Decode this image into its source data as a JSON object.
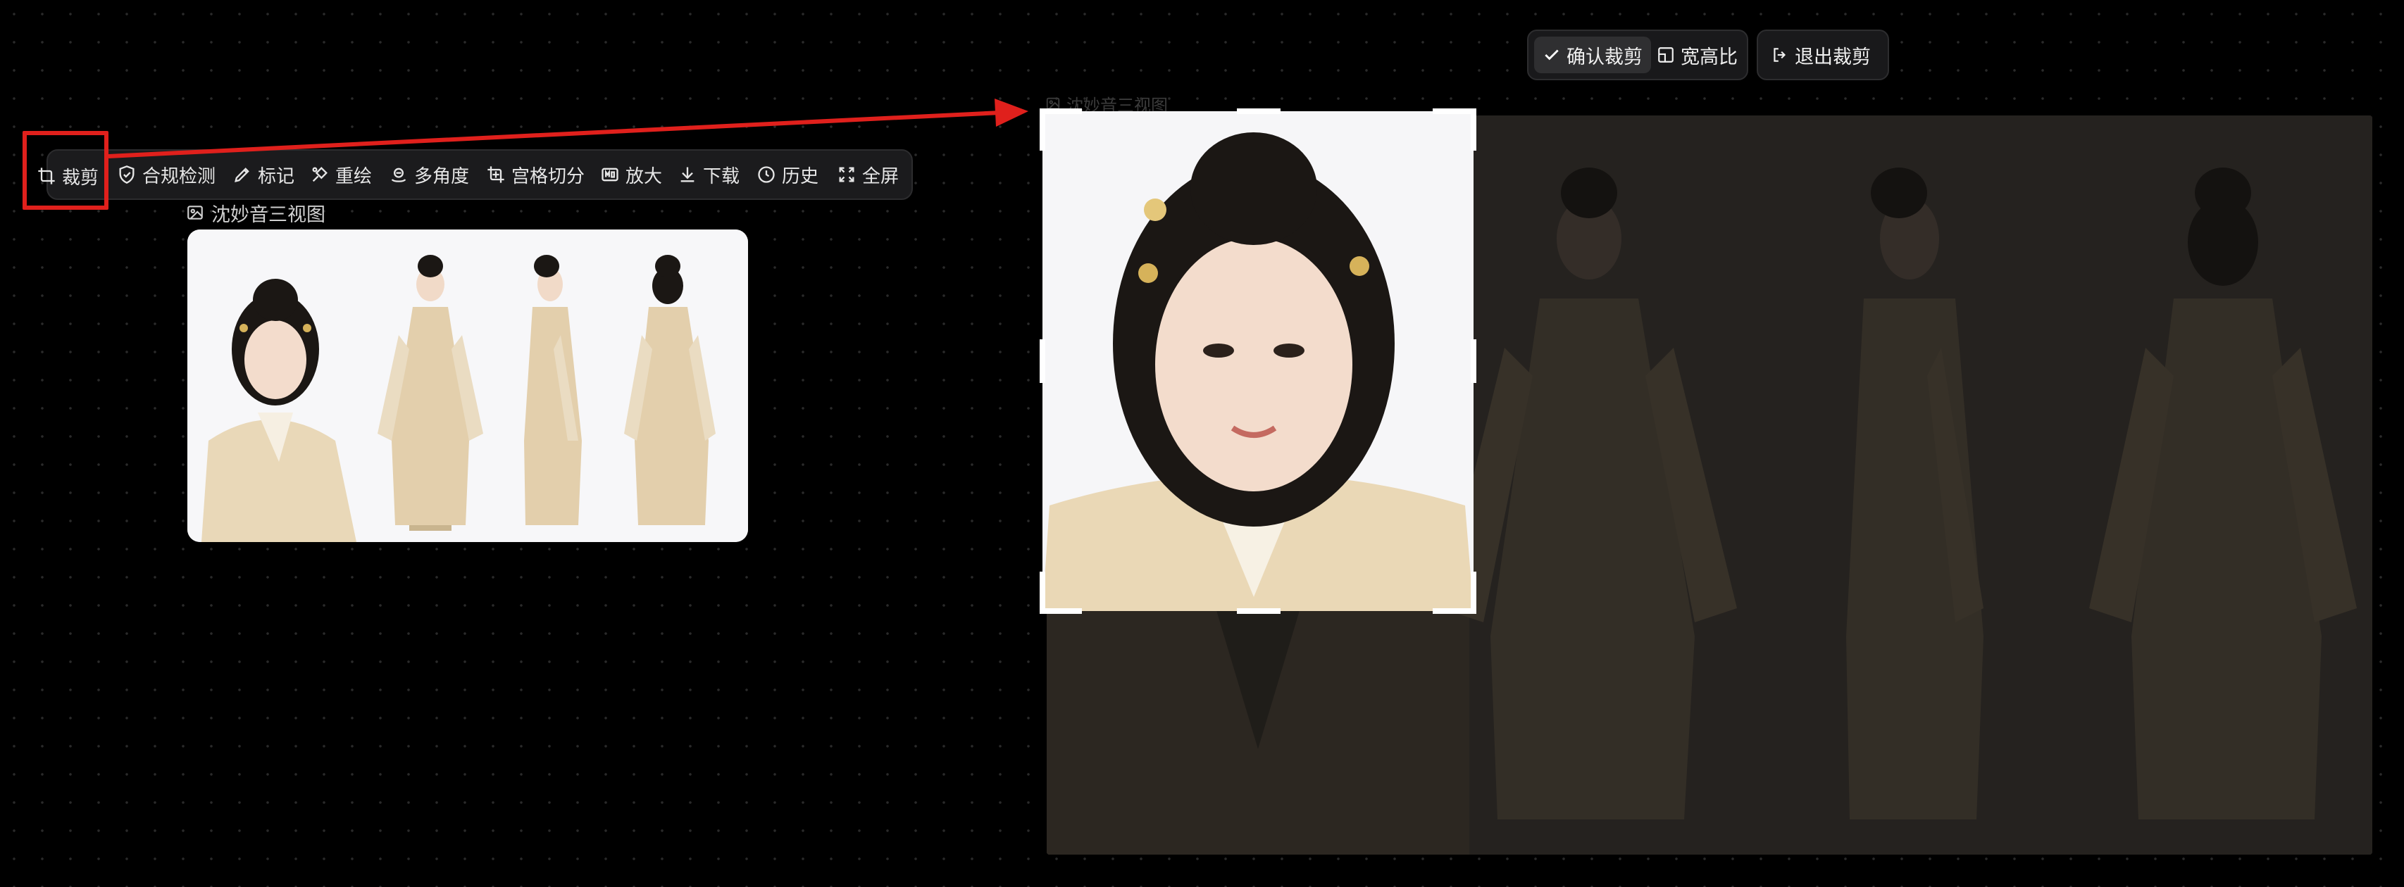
{
  "toolbar": {
    "items": [
      {
        "label": "裁剪",
        "icon": "crop-icon"
      },
      {
        "label": "合规检测",
        "icon": "shield-check-icon"
      },
      {
        "label": "标记",
        "icon": "pen-icon"
      },
      {
        "label": "重绘",
        "icon": "redraw-icon"
      },
      {
        "label": "多角度",
        "icon": "multi-angle-icon"
      },
      {
        "label": "宫格切分",
        "icon": "grid-split-icon"
      },
      {
        "label": "放大",
        "icon": "upscale-icon"
      },
      {
        "label": "下载",
        "icon": "download-icon"
      },
      {
        "label": "历史",
        "icon": "history-icon"
      },
      {
        "label": "全屏",
        "icon": "fullscreen-icon"
      }
    ]
  },
  "card": {
    "title": "沈妙音三视图"
  },
  "editor": {
    "ghost_title": "沈妙音三视图",
    "actions": {
      "confirm_label": "确认裁剪",
      "aspect_label": "宽高比",
      "exit_label": "退出裁剪"
    }
  },
  "colors": {
    "highlight_red": "#e0201c",
    "background": "#000000",
    "toolbar_bg": "#1b1b1d"
  }
}
